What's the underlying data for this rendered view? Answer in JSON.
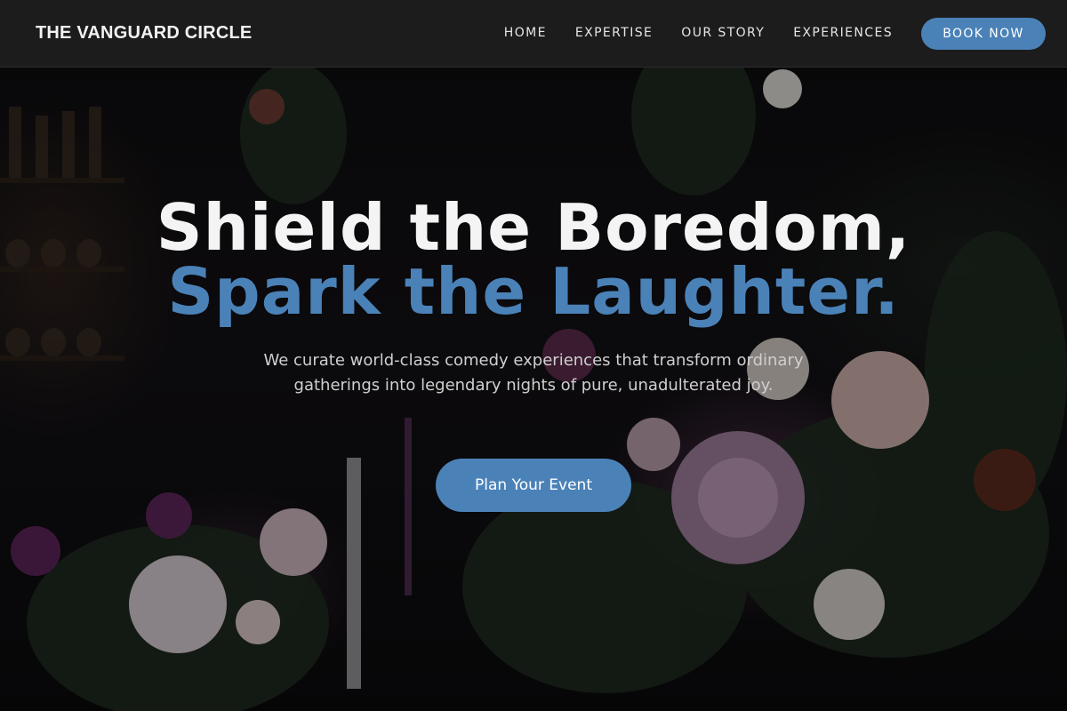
{
  "header": {
    "brand": "THE VANGUARD CIRCLE",
    "nav": [
      {
        "label": "HOME"
      },
      {
        "label": "EXPERTISE"
      },
      {
        "label": "OUR STORY"
      },
      {
        "label": "EXPERIENCES"
      }
    ],
    "cta_label": "BOOK NOW"
  },
  "hero": {
    "headline_line1": "Shield the Boredom,",
    "headline_line2": "Spark the Laughter.",
    "subtext": "We curate world-class comedy experiences that transform ordinary gatherings into legendary nights of pure, unadulterated joy.",
    "cta_label": "Plan Your Event"
  },
  "colors": {
    "accent": "#4a82b8",
    "header_bg": "#1c1c1d",
    "headline": "#f4f4f4",
    "body_text": "#cfcfcf"
  },
  "background": {
    "image": "dark-floral-arrangement-photo"
  }
}
